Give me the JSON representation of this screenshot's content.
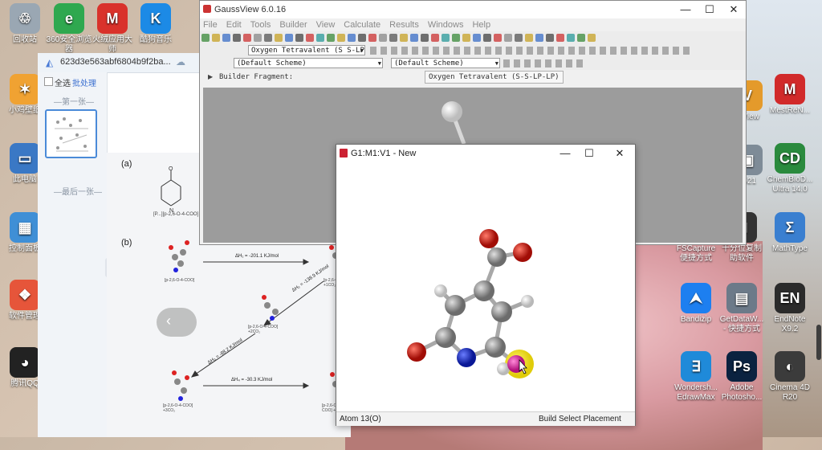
{
  "desktop_icons_left": [
    {
      "label": "回收站",
      "color": "#9aa7b3",
      "glyph": "♲"
    },
    {
      "label": "360安全浏览器",
      "color": "#2fa84f",
      "glyph": "e"
    },
    {
      "label": "火绒应用大师",
      "color": "#d9322b",
      "glyph": "M"
    },
    {
      "label": "酷狗音乐",
      "color": "#1c8ae6",
      "glyph": "K"
    },
    {
      "label": "小鸡壁纸",
      "color": "#f0a232",
      "glyph": "✶"
    },
    {
      "label": "此电脑",
      "color": "#3a78c5",
      "glyph": "▭"
    },
    {
      "label": "控制面板",
      "color": "#3f8fd6",
      "glyph": "▦"
    },
    {
      "label": "软件管理",
      "color": "#e6553a",
      "glyph": "❖"
    },
    {
      "label": "腾讯QQ",
      "color": "#222222",
      "glyph": "◕"
    }
  ],
  "desktop_icons_right": [
    {
      "label": "...View",
      "color": "#e49a2b",
      "glyph": "V"
    },
    {
      "label": "MestReN...",
      "color": "#d12a2a",
      "glyph": "M"
    },
    {
      "label": "2021",
      "color": "#7e8b97",
      "glyph": "▣"
    },
    {
      "label": "ChemBioD... Ultra 14.0",
      "color": "#2a8a3d",
      "glyph": "CD"
    },
    {
      "label": "FSCapture 便捷方式",
      "color": "#2c3e50",
      "glyph": "◉"
    },
    {
      "label": "千分位复制 助软件",
      "color": "#333333",
      "glyph": "⊞"
    },
    {
      "label": "MathType",
      "color": "#3a7fd0",
      "glyph": "Σ"
    },
    {
      "label": "Bandizip",
      "color": "#1d7ff0",
      "glyph": "⮝"
    },
    {
      "label": "GetDataW... - 快捷方式",
      "color": "#6c7a89",
      "glyph": "▤"
    },
    {
      "label": "EndNote X9.2",
      "color": "#2b2b2b",
      "glyph": "EN"
    },
    {
      "label": "Wondersh... EdrawMax",
      "color": "#1f8ad9",
      "glyph": "∃"
    },
    {
      "label": "Adobe Photosho...",
      "color": "#0b2240",
      "glyph": "Ps"
    },
    {
      "label": "Cinema 4D R20",
      "color": "#3b3b3b",
      "glyph": "◐"
    }
  ],
  "viewer": {
    "title": "623d3e563abf6804b9f2ba...",
    "select_all": "全选",
    "batch": "批处理",
    "first_label": "—第一张—",
    "last_label": "—最后一张—",
    "fig_a": "(a)",
    "fig_b": "(b)",
    "label_a": "[P...][p-2,6-O-4-COO]",
    "eq1": "ΔH₁ = -201.1 KJ/mol",
    "eq2": "ΔH₂ = -138.9 KJ/mol",
    "eq3": "ΔH₃ = -88.2 KJ/mol",
    "eq4": "ΔH₄ = -30.3 KJ/mol",
    "mol_label1": "[p-2,6-O-4-COO]",
    "mol_label2": "[p-2,6-O-4-COO] +1CO₂",
    "mol_label3": "[p-2,6-O-4-COO] +2CO₂",
    "mol_label4": "[p-2,6-O-4-COO] +3CO₂",
    "mol_label5": "[p-2,6-O-4-COO] +4CO₂"
  },
  "gaussview": {
    "title": "GaussView 6.0.16",
    "menus": [
      "File",
      "Edit",
      "Tools",
      "Builder",
      "View",
      "Calculate",
      "Results",
      "Windows",
      "Help"
    ],
    "fragment_combo": "Oxygen Tetravalent (S S-LP",
    "scheme1": "(Default Scheme)",
    "scheme2": "(Default Scheme)",
    "builder_label": "Builder Fragment:",
    "builder_value": "Oxygen Tetravalent (S-S-LP-LP)"
  },
  "molwin": {
    "title": "G1:M1:V1 - New",
    "status_left": "Atom 13(O)",
    "status_right": "Build  Select Placement"
  },
  "colors": {
    "carbon": "#8c8c8c",
    "oxygen": "#d41a12",
    "nitrogen": "#1a2bd0",
    "hydrogen": "#e6e6e6",
    "highlight": "#f2e21a",
    "selected": "#d63aa6"
  }
}
